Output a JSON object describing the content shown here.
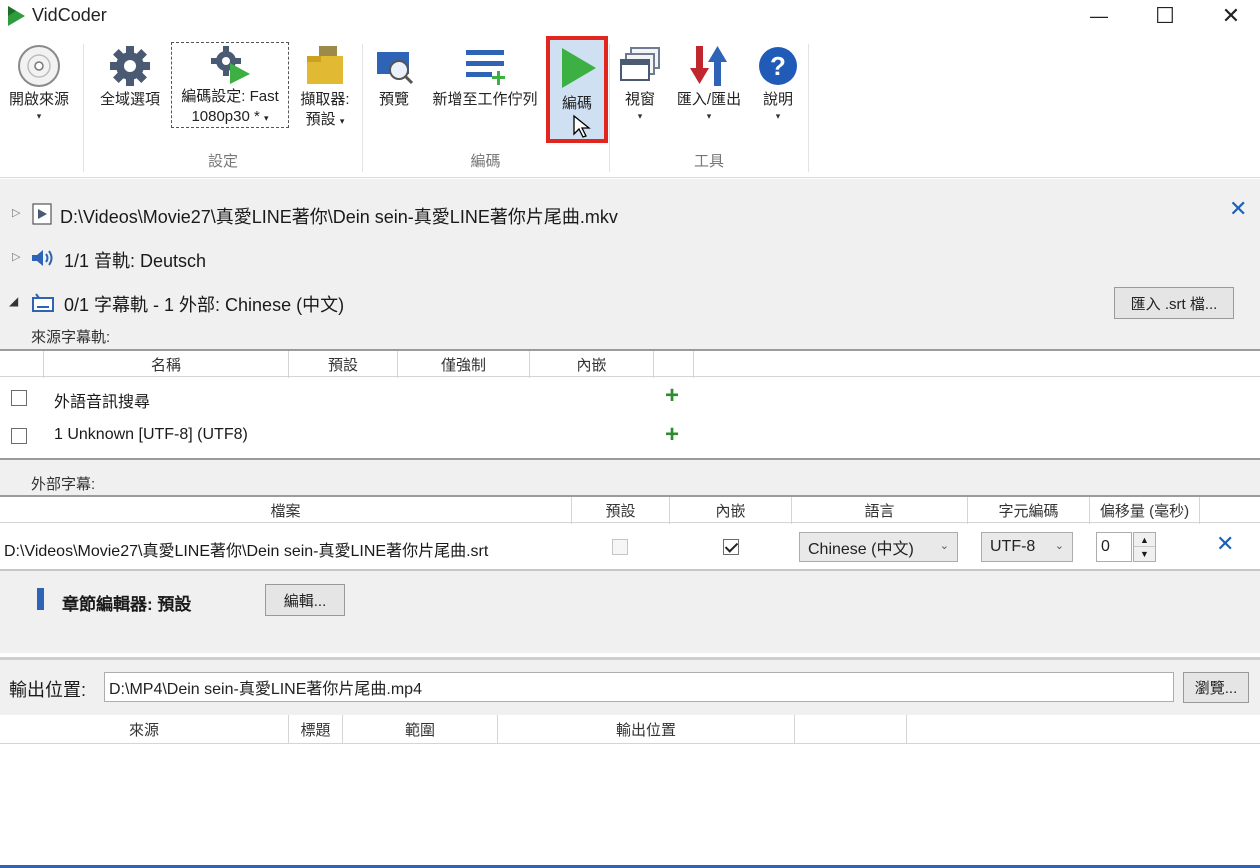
{
  "window": {
    "title": "VidCoder",
    "minimize": "—",
    "maximize": "☐",
    "close": "✕"
  },
  "ribbon": {
    "open_source": "開啟來源",
    "global_options": "全域選項",
    "encoding_settings_line1": "編碼設定: Fast",
    "encoding_settings_line2": "1080p30 *",
    "picker_line1": "擷取器:",
    "picker_line2": "預設",
    "preview": "預覽",
    "add_to_queue": "新增至工作佇列",
    "encode": "編碼",
    "window_menu": "視窗",
    "import_export": "匯入/匯出",
    "help": "說明",
    "group_settings": "設定",
    "group_encode": "編碼",
    "group_tools": "工具",
    "dropdown_arrow": "▾"
  },
  "source": {
    "video_path": "D:\\Videos\\Movie27\\真愛LINE著你\\Dein sein-真愛LINE著你片尾曲.mkv",
    "audio_summary": "1/1 音軌: Deutsch",
    "subtitle_summary": "0/1 字幕軌 - 1 外部: Chinese (中文)",
    "import_srt_button": "匯入 .srt 檔..."
  },
  "source_subtitles": {
    "label": "來源字幕軌:",
    "columns": [
      "名稱",
      "預設",
      "僅強制",
      "內嵌"
    ],
    "rows": [
      {
        "name": "外語音訊搜尋",
        "add": "+"
      },
      {
        "name": "1 Unknown [UTF-8] (UTF8)",
        "add": "+"
      }
    ]
  },
  "external_subtitles": {
    "label": "外部字幕:",
    "columns": [
      "檔案",
      "預設",
      "內嵌",
      "語言",
      "字元編碼",
      "偏移量 (毫秒)"
    ],
    "rows": [
      {
        "file": "D:\\Videos\\Movie27\\真愛LINE著你\\Dein sein-真愛LINE著你片尾曲.srt",
        "default_checked": false,
        "burn_in_checked": true,
        "language": "Chinese (中文)",
        "encoding": "UTF-8",
        "offset": "0"
      }
    ]
  },
  "chapters": {
    "label": "章節編輯器: 預設",
    "edit_button": "編輯..."
  },
  "output": {
    "label": "輸出位置:",
    "path": "D:\\MP4\\Dein sein-真愛LINE著你片尾曲.mp4",
    "browse_button": "瀏覽..."
  },
  "queue": {
    "columns": [
      "來源",
      "標題",
      "範圍",
      "輸出位置"
    ]
  },
  "colors": {
    "accent_blue": "#1c5fb8",
    "highlight_red": "#e0261e",
    "play_green": "#3cb043"
  }
}
